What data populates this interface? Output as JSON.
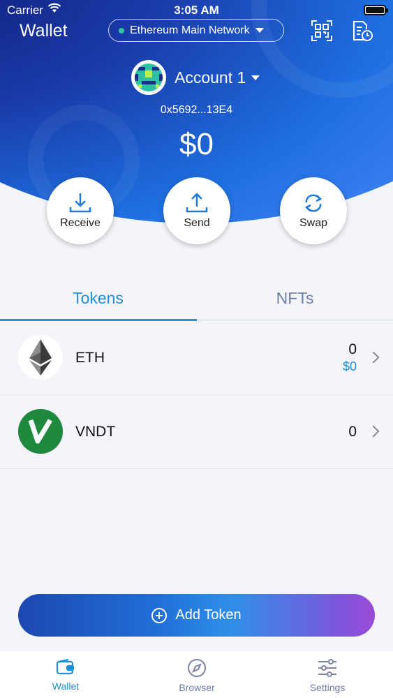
{
  "status_bar": {
    "carrier": "Carrier",
    "time": "3:05 AM"
  },
  "header": {
    "title": "Wallet",
    "network": "Ethereum Main Network",
    "icons": [
      "qr-scan-icon",
      "document-clock-icon"
    ]
  },
  "account": {
    "name": "Account 1",
    "address": "0x5692...13E4",
    "balance": "$0"
  },
  "actions": [
    {
      "label": "Receive",
      "icon": "download-icon"
    },
    {
      "label": "Send",
      "icon": "upload-icon"
    },
    {
      "label": "Swap",
      "icon": "swap-arrows-icon"
    }
  ],
  "tabs": [
    {
      "label": "Tokens",
      "active": true
    },
    {
      "label": "NFTs",
      "active": false
    }
  ],
  "tokens": [
    {
      "symbol": "ETH",
      "amount": "0",
      "fiat": "$0"
    },
    {
      "symbol": "VNDT",
      "amount": "0",
      "fiat": ""
    }
  ],
  "add_token": {
    "label": "Add Token"
  },
  "tabbar": [
    {
      "label": "Wallet",
      "active": true,
      "icon": "wallet-icon"
    },
    {
      "label": "Browser",
      "active": false,
      "icon": "compass-icon"
    },
    {
      "label": "Settings",
      "active": false,
      "icon": "sliders-icon"
    }
  ],
  "colors": {
    "accent": "#1f8fd9",
    "inactive_tab": "#6f7ea7",
    "network_dot": "#34c3a0"
  }
}
